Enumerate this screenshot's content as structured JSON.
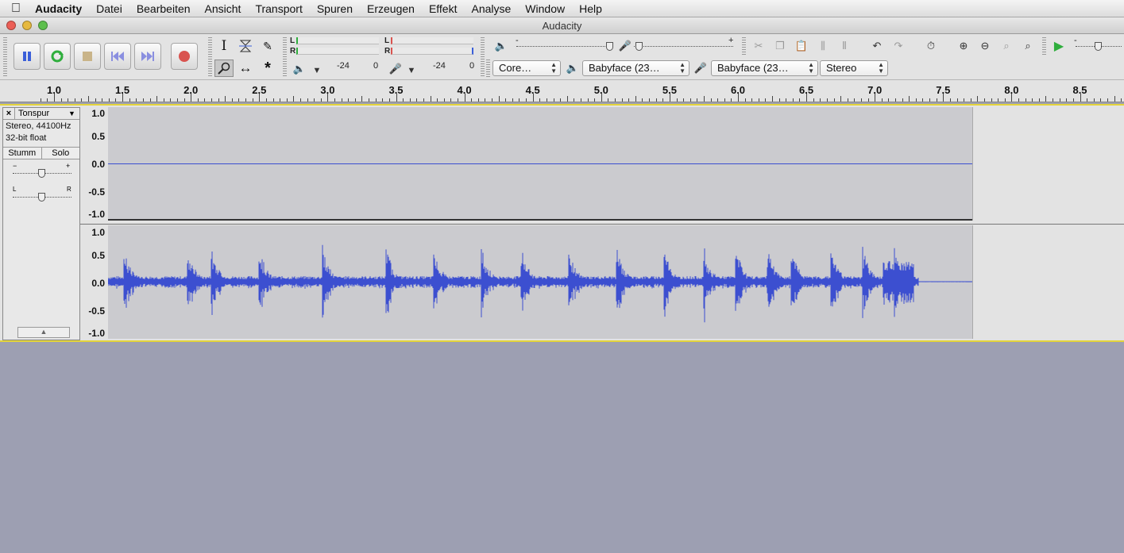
{
  "menubar": {
    "apple_icon": "apple-icon",
    "items": [
      "Audacity",
      "Datei",
      "Bearbeiten",
      "Ansicht",
      "Transport",
      "Spuren",
      "Erzeugen",
      "Effekt",
      "Analyse",
      "Window",
      "Help"
    ]
  },
  "window": {
    "title": "Audacity"
  },
  "transport": {
    "buttons": [
      "pause",
      "loop-play",
      "stop",
      "skip-to-start",
      "skip-to-end",
      "record"
    ],
    "accent": "#3b5fd9",
    "record_color": "#d9534f"
  },
  "meters": {
    "playback_l": "L",
    "playback_r": "R",
    "playback_scale_a": "-24",
    "playback_scale_b": "0",
    "record_l": "L",
    "record_r": "R",
    "record_scale_a": "-24",
    "record_scale_b": "0"
  },
  "mixer": {
    "minus": "-",
    "plus": "+"
  },
  "devices": {
    "host": "Core…",
    "playback": "Babyface (23…",
    "recording": "Babyface (23…",
    "channels": "Stereo"
  },
  "ruler": {
    "labels": [
      "1.0",
      "1.5",
      "2.0",
      "2.5",
      "3.0",
      "3.5",
      "4.0",
      "4.5",
      "5.0",
      "5.5",
      "6.0",
      "6.5",
      "7.0",
      "7.5",
      "8.0",
      "8.5"
    ]
  },
  "track": {
    "name": "Tonspur",
    "close": "×",
    "format_line1": "Stereo, 44100Hz",
    "format_line2": "32-bit float",
    "mute": "Stumm",
    "solo": "Solo",
    "gain_minus": "−",
    "gain_plus": "+",
    "pan_left": "L",
    "pan_right": "R",
    "wave_color": "#3c4fd0",
    "scale_labels": [
      "1.0",
      "0.5",
      "0.0",
      "-0.5",
      "-1.0"
    ]
  }
}
